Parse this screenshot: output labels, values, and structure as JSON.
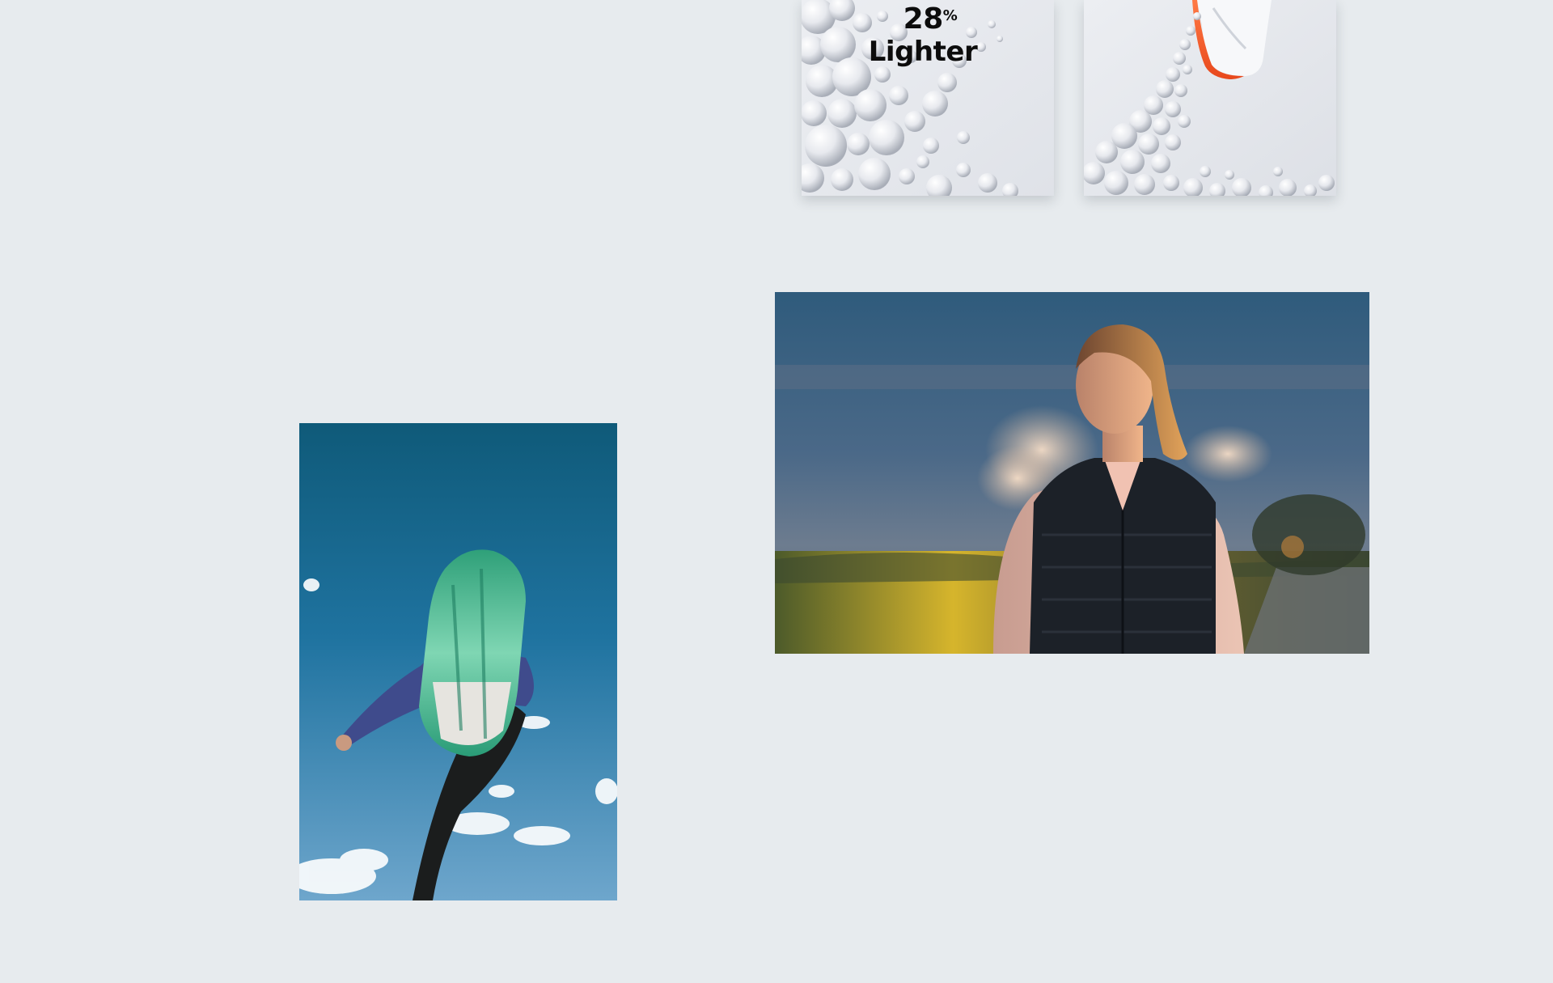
{
  "gallery": {
    "tile_lighter": {
      "number": "28",
      "unit": "%",
      "word": "Lighter"
    }
  }
}
